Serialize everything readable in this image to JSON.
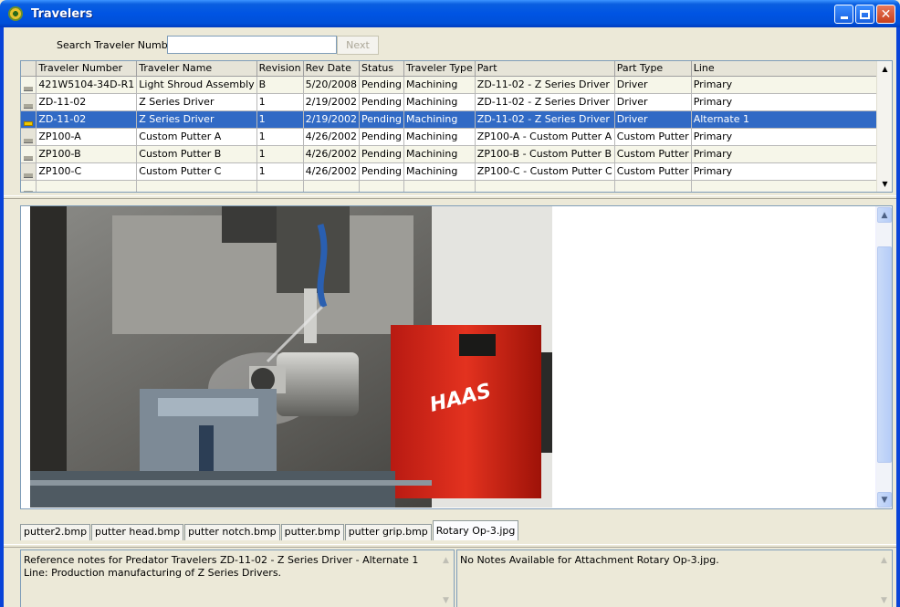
{
  "window": {
    "title": "Travelers"
  },
  "search": {
    "label": "Search Traveler Number :",
    "value": "",
    "next_label": "Next"
  },
  "grid": {
    "columns": [
      "Traveler Number",
      "Traveler Name",
      "Revision",
      "Rev Date",
      "Status",
      "Traveler Type",
      "Part",
      "Part Type",
      "Line"
    ],
    "rows": [
      [
        "421W5104-34D-R1",
        "Light Shroud Assembly",
        "B",
        "5/20/2008",
        "Pending",
        "Machining",
        "ZD-11-02 - Z Series Driver",
        "Driver",
        "Primary"
      ],
      [
        "ZD-11-02",
        "Z Series Driver",
        "1",
        "2/19/2002",
        "Pending",
        "Machining",
        "ZD-11-02 - Z Series Driver",
        "Driver",
        "Primary"
      ],
      [
        "ZD-11-02",
        "Z Series Driver",
        "1",
        "2/19/2002",
        "Pending",
        "Machining",
        "ZD-11-02 - Z Series Driver",
        "Driver",
        "Alternate  1"
      ],
      [
        "ZP100-A",
        "Custom Putter A",
        "1",
        "4/26/2002",
        "Pending",
        "Machining",
        "ZP100-A - Custom Putter A",
        "Custom Putter",
        "Primary"
      ],
      [
        "ZP100-B",
        "Custom Putter B",
        "1",
        "4/26/2002",
        "Pending",
        "Machining",
        "ZP100-B - Custom Putter B",
        "Custom Putter",
        "Primary"
      ],
      [
        "ZP100-C",
        "Custom Putter C",
        "1",
        "4/26/2002",
        "Pending",
        "Machining",
        "ZP100-C - Custom Putter C",
        "Custom Putter",
        "Primary"
      ],
      [
        "",
        "",
        "",
        "",
        "",
        "",
        "",
        "",
        ""
      ]
    ],
    "selected_row": 2
  },
  "image": {
    "brand_text": "HAAS"
  },
  "tabs": [
    {
      "label": "putter2.bmp"
    },
    {
      "label": "putter head.bmp"
    },
    {
      "label": "putter notch.bmp"
    },
    {
      "label": "putter.bmp"
    },
    {
      "label": "putter grip.bmp"
    },
    {
      "label": "Rotary Op-3.jpg",
      "active": true
    }
  ],
  "notes": {
    "reference": "Reference notes for Predator Travelers ZD-11-02 - Z Series Driver - Alternate  1 Line: Production manufacturing of Z Series Drivers.",
    "attachment": "No Notes Available for Attachment Rotary Op-3.jpg."
  },
  "colors": {
    "selection": "#316ac5",
    "titlebar": "#0054e3",
    "alt_row": "#f6f6e9"
  }
}
